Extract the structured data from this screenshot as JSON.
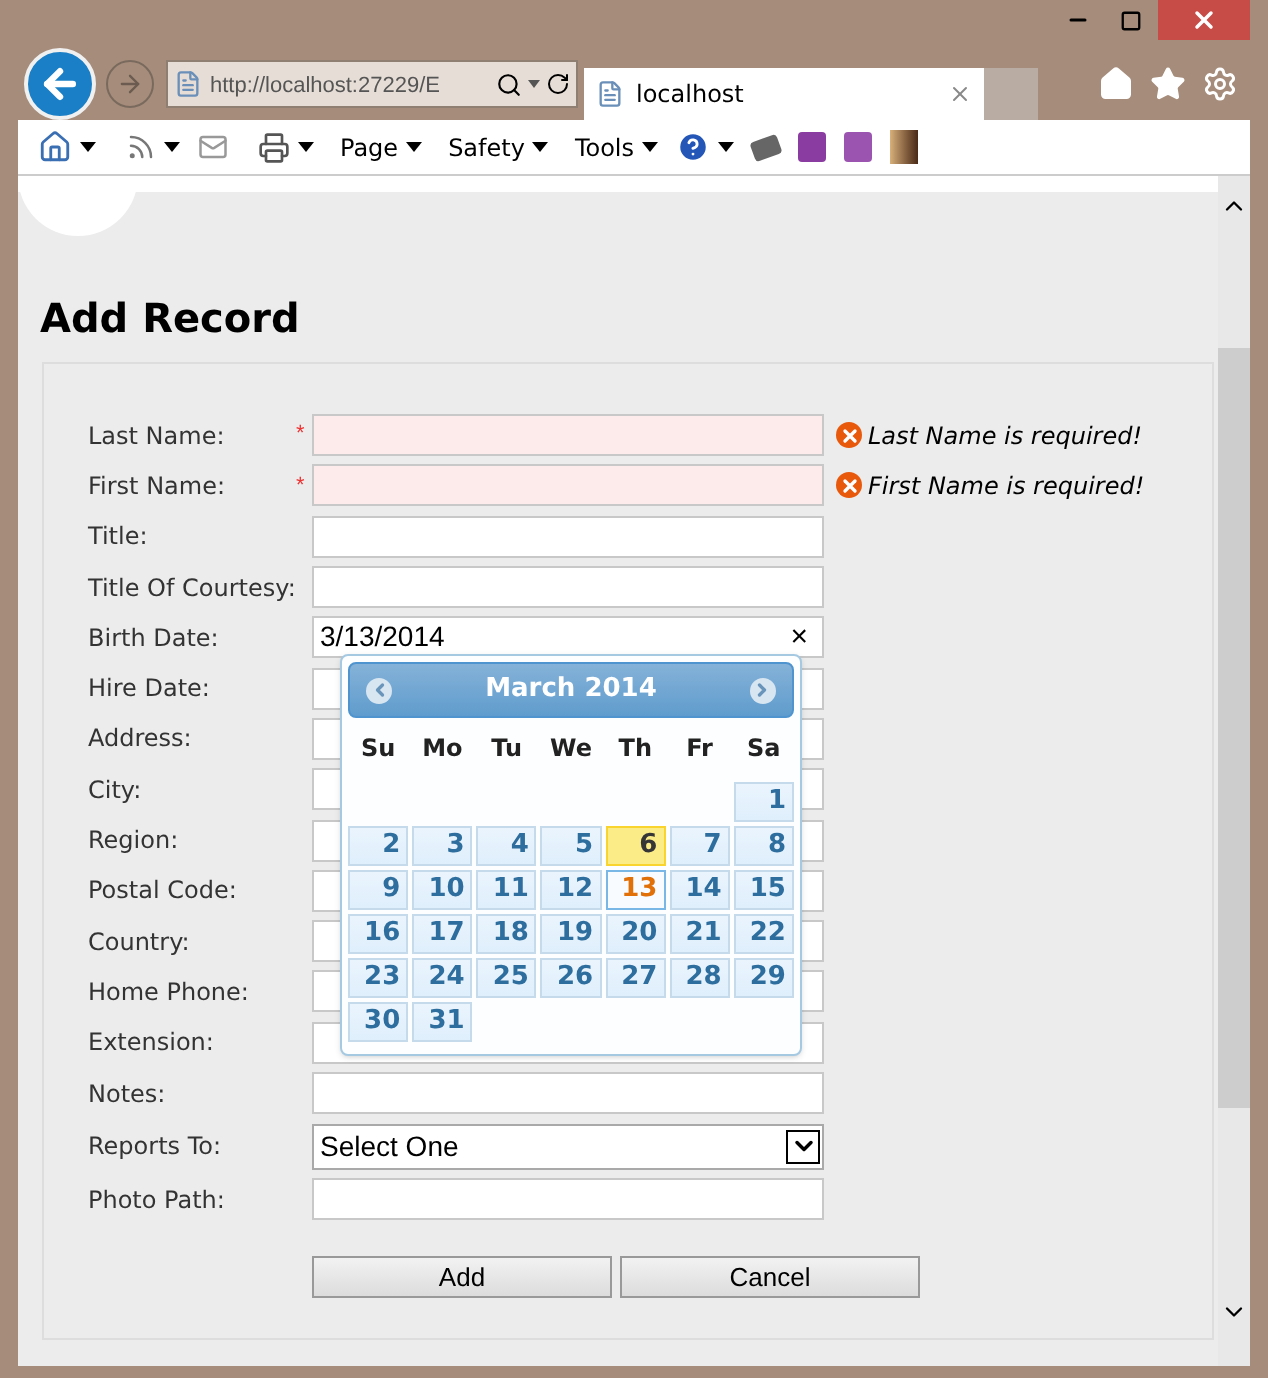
{
  "browser": {
    "address": "http://localhost:27229/E",
    "tab_title": "localhost",
    "menus": [
      "Page",
      "Safety",
      "Tools"
    ]
  },
  "page": {
    "title": "Add Record"
  },
  "fields": [
    {
      "label": "Last Name:",
      "kind": "text",
      "required_mark": "*",
      "error": "Last Name is required!"
    },
    {
      "label": "First Name:",
      "kind": "text",
      "required_mark": "*",
      "error": "First Name is required!"
    },
    {
      "label": "Title:",
      "kind": "text"
    },
    {
      "label": "Title Of Courtesy:",
      "kind": "text"
    },
    {
      "label": "Birth Date:",
      "kind": "date",
      "value": "3/13/2014",
      "clear": "×"
    },
    {
      "label": "Hire Date:",
      "kind": "text"
    },
    {
      "label": "Address:",
      "kind": "text"
    },
    {
      "label": "City:",
      "kind": "text"
    },
    {
      "label": "Region:",
      "kind": "text"
    },
    {
      "label": "Postal Code:",
      "kind": "text"
    },
    {
      "label": "Country:",
      "kind": "text"
    },
    {
      "label": "Home Phone:",
      "kind": "text"
    },
    {
      "label": "Extension:",
      "kind": "text"
    },
    {
      "label": "Notes:",
      "kind": "text"
    },
    {
      "label": "Reports To:",
      "kind": "select",
      "value": "Select One"
    },
    {
      "label": "Photo Path:",
      "kind": "text"
    }
  ],
  "calendar": {
    "title": "March 2014",
    "weekdays": [
      "Su",
      "Mo",
      "Tu",
      "We",
      "Th",
      "Fr",
      "Sa"
    ],
    "weeks": [
      [
        {
          "kind": "blank"
        },
        {
          "kind": "blank"
        },
        {
          "kind": "blank"
        },
        {
          "kind": "blank"
        },
        {
          "kind": "blank"
        },
        {
          "kind": "blank"
        },
        {
          "kind": "day",
          "label": "1",
          "today": false,
          "selected": false
        }
      ],
      [
        {
          "kind": "day",
          "label": "2",
          "today": false,
          "selected": false
        },
        {
          "kind": "day",
          "label": "3",
          "today": false,
          "selected": false
        },
        {
          "kind": "day",
          "label": "4",
          "today": false,
          "selected": false
        },
        {
          "kind": "day",
          "label": "5",
          "today": false,
          "selected": false
        },
        {
          "kind": "day",
          "label": "6",
          "today": true,
          "selected": false
        },
        {
          "kind": "day",
          "label": "7",
          "today": false,
          "selected": false
        },
        {
          "kind": "day",
          "label": "8",
          "today": false,
          "selected": false
        }
      ],
      [
        {
          "kind": "day",
          "label": "9",
          "today": false,
          "selected": false
        },
        {
          "kind": "day",
          "label": "10",
          "today": false,
          "selected": false
        },
        {
          "kind": "day",
          "label": "11",
          "today": false,
          "selected": false
        },
        {
          "kind": "day",
          "label": "12",
          "today": false,
          "selected": false
        },
        {
          "kind": "day",
          "label": "13",
          "today": false,
          "selected": true
        },
        {
          "kind": "day",
          "label": "14",
          "today": false,
          "selected": false
        },
        {
          "kind": "day",
          "label": "15",
          "today": false,
          "selected": false
        }
      ],
      [
        {
          "kind": "day",
          "label": "16",
          "today": false,
          "selected": false
        },
        {
          "kind": "day",
          "label": "17",
          "today": false,
          "selected": false
        },
        {
          "kind": "day",
          "label": "18",
          "today": false,
          "selected": false
        },
        {
          "kind": "day",
          "label": "19",
          "today": false,
          "selected": false
        },
        {
          "kind": "day",
          "label": "20",
          "today": false,
          "selected": false
        },
        {
          "kind": "day",
          "label": "21",
          "today": false,
          "selected": false
        },
        {
          "kind": "day",
          "label": "22",
          "today": false,
          "selected": false
        }
      ],
      [
        {
          "kind": "day",
          "label": "23",
          "today": false,
          "selected": false
        },
        {
          "kind": "day",
          "label": "24",
          "today": false,
          "selected": false
        },
        {
          "kind": "day",
          "label": "25",
          "today": false,
          "selected": false
        },
        {
          "kind": "day",
          "label": "26",
          "today": false,
          "selected": false
        },
        {
          "kind": "day",
          "label": "27",
          "today": false,
          "selected": false
        },
        {
          "kind": "day",
          "label": "28",
          "today": false,
          "selected": false
        },
        {
          "kind": "day",
          "label": "29",
          "today": false,
          "selected": false
        }
      ],
      [
        {
          "kind": "day",
          "label": "30",
          "today": false,
          "selected": false
        },
        {
          "kind": "day",
          "label": "31",
          "today": false,
          "selected": false
        }
      ]
    ]
  },
  "buttons": [
    "Add",
    "Cancel"
  ]
}
